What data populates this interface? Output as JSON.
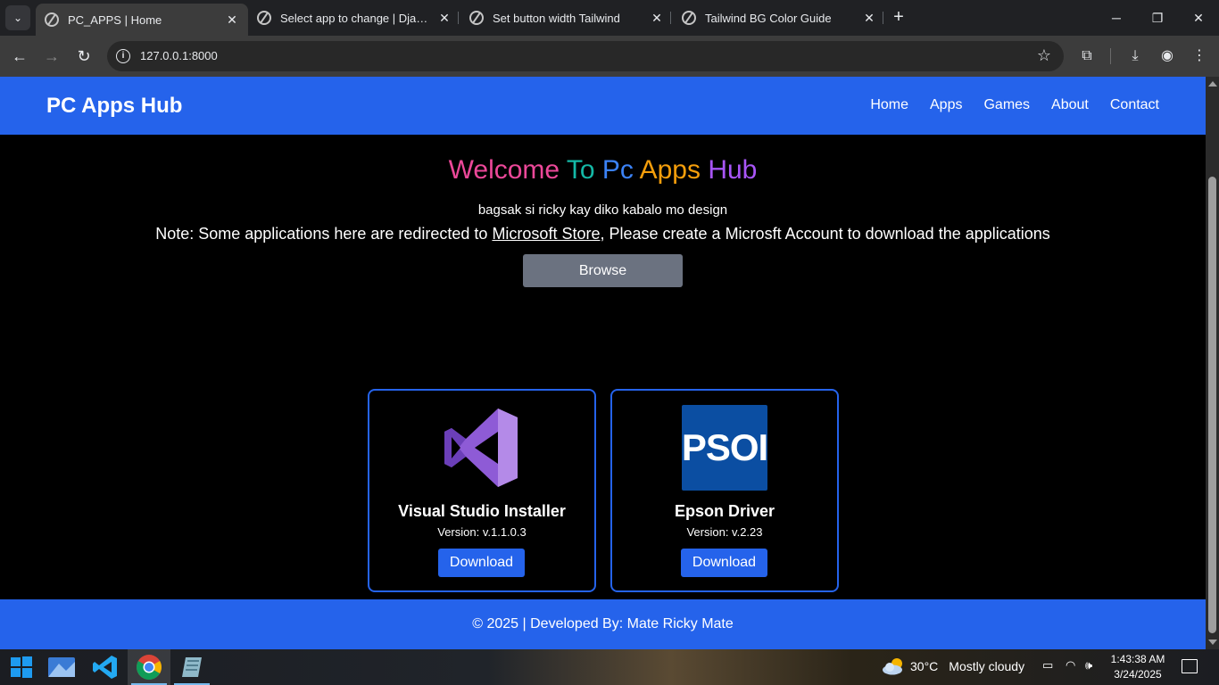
{
  "browser": {
    "tabs": [
      {
        "title": "PC_APPS | Home",
        "active": true
      },
      {
        "title": "Select app to change | Django site admin",
        "active": false
      },
      {
        "title": "Set button width Tailwind",
        "active": false
      },
      {
        "title": "Tailwind BG Color Guide",
        "active": false
      }
    ],
    "url": "127.0.0.1:8000"
  },
  "site": {
    "brand": "PC Apps Hub",
    "nav": [
      "Home",
      "Apps",
      "Games",
      "About",
      "Contact"
    ],
    "hero": {
      "title_words": [
        {
          "text": "Welcome",
          "color": "#ec4899"
        },
        {
          "text": "To",
          "color": "#14b8a6"
        },
        {
          "text": "Pc",
          "color": "#3b82f6"
        },
        {
          "text": "Apps",
          "color": "#f59e0b"
        },
        {
          "text": "Hub",
          "color": "#a855f7"
        }
      ],
      "subtitle": "bagsak si ricky kay diko kabalo mo design",
      "note_prefix": "Note: Some applications here are redirected to ",
      "note_link": "Microsoft Store",
      "note_suffix": ", Please create a Microsft Account to download the applications",
      "browse_label": "Browse"
    },
    "apps": [
      {
        "name": "Visual Studio Installer",
        "version": "Version: v.1.1.0.3",
        "download_label": "Download",
        "icon": "visual-studio-icon"
      },
      {
        "name": "Epson Driver",
        "version": "Version: v.2.23",
        "download_label": "Download",
        "icon": "epson-icon",
        "logo_text": "PSOI"
      }
    ],
    "footer": "© 2025 | Developed By: Mate Ricky Mate"
  },
  "taskbar": {
    "weather_temp": "30°C",
    "weather_desc": "Mostly cloudy",
    "time": "1:43:38 AM",
    "date": "3/24/2025"
  }
}
